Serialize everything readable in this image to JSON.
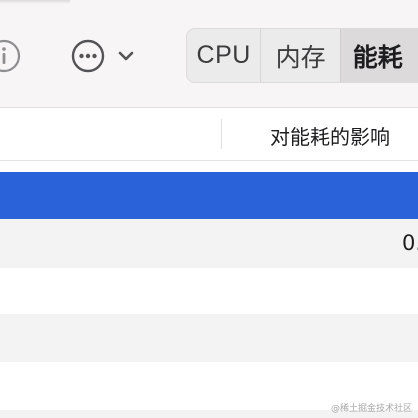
{
  "toolbar": {
    "info_icon": "info-circle-icon",
    "more_icon": "ellipsis-circle-icon",
    "chevron_icon": "chevron-down-icon",
    "segments": [
      {
        "label": "CPU",
        "selected": false
      },
      {
        "label": "内存",
        "selected": false
      },
      {
        "label": "能耗",
        "selected": true
      }
    ]
  },
  "table": {
    "columns": [
      {
        "label": "对能耗的影响"
      }
    ],
    "rows": [
      {
        "selected": true,
        "energy_impact": ""
      },
      {
        "selected": false,
        "energy_impact": "0."
      },
      {
        "selected": false,
        "energy_impact": ""
      },
      {
        "selected": false,
        "energy_impact": ""
      },
      {
        "selected": false,
        "energy_impact": ""
      }
    ]
  },
  "colors": {
    "selection": "#2a62d9",
    "toolbar_bg": "#f7f5f6",
    "alt_row": "#f3f3f3"
  },
  "watermark": "@稀土掘金技术社区"
}
